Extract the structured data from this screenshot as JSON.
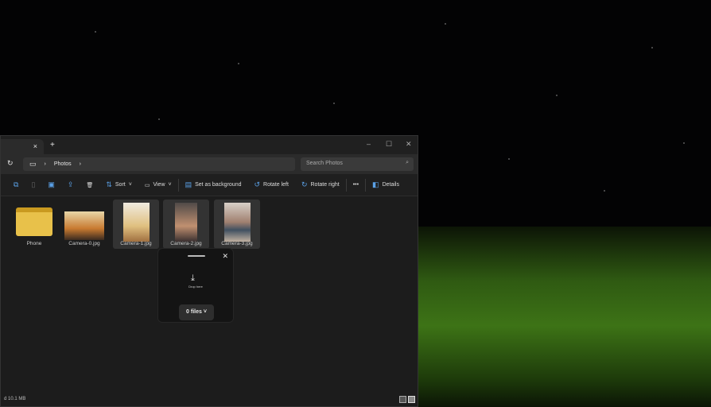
{
  "tab": {
    "close": "×",
    "new": "+"
  },
  "window_controls": {
    "minimize": "–",
    "maximize": "☐",
    "close": "✕"
  },
  "address": {
    "refresh": "↻",
    "breadcrumb": [
      "Photos"
    ],
    "sep": "›",
    "search_placeholder": "Search Photos"
  },
  "toolbar": {
    "sort": "Sort",
    "view": "View",
    "set_bg": "Set as background",
    "rotate_left": "Rotate left",
    "rotate_right": "Rotate right",
    "more": "•••",
    "details": "Details"
  },
  "items": [
    {
      "label": "Phone"
    },
    {
      "label": "Camera-0.jpg"
    },
    {
      "label": "Camera-1.jpg"
    },
    {
      "label": "Camera-2.jpg"
    },
    {
      "label": "Camera-3.jpg"
    }
  ],
  "status": {
    "text": "d  10.1 MB"
  },
  "drop": {
    "close": "✕",
    "text": "Drop here",
    "files": "0 files"
  }
}
